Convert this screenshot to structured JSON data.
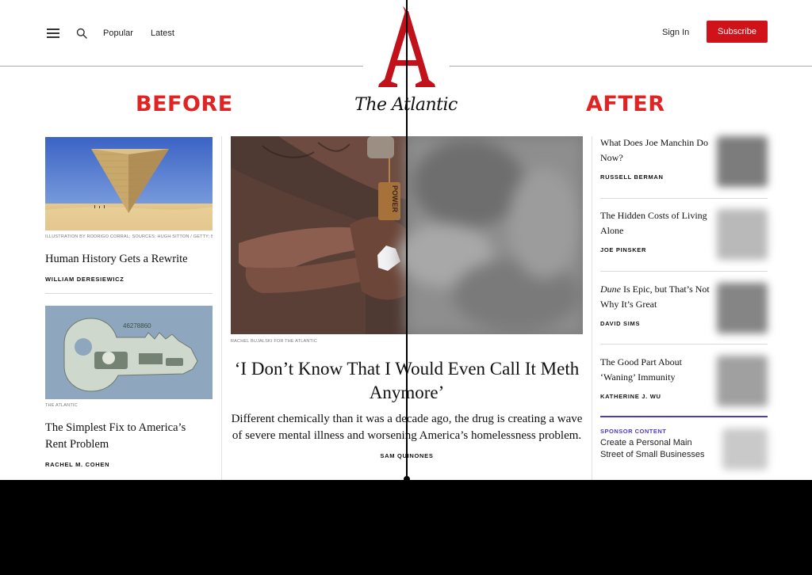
{
  "nav": {
    "popular": "Popular",
    "latest": "Latest",
    "sign_in": "Sign In",
    "subscribe": "Subscribe"
  },
  "brand": {
    "logo_letter": "A",
    "wordmark": "The Atlantic",
    "brand_red": "#d0121b"
  },
  "labels": {
    "before": "BEFORE",
    "after": "AFTER",
    "label_color": "#e02424"
  },
  "left_column": [
    {
      "credit": "ILLUSTRATION BY RODRIGO CORRAL; SOURCES: HUGH SITTON / GETTY; BE...",
      "headline": "Human History Gets a Rewrite",
      "byline": "WILLIAM DERESIEWICZ",
      "image": "inverted-pyramid-desert"
    },
    {
      "credit": "THE ATLANTIC",
      "headline": "The Simplest Fix to America’s Rent Problem",
      "byline": "RACHEL M. COHEN",
      "image": "dollar-bill-key"
    }
  ],
  "hero": {
    "credit": "RACHEL BUJALSKI FOR THE ATLANTIC",
    "pendant_text": "POWER",
    "headline": "‘I Don’t Know That I Would Even Call It Meth Anymore’",
    "dek": "Different chemically than it was a decade ago, the drug is creating a wave of severe mental illness and worsening America’s homelessness problem.",
    "byline": "SAM QUINONES"
  },
  "right_column": [
    {
      "headline": "What Does Joe Manchin Do Now?",
      "byline": "RUSSELL BERMAN",
      "headline_italic": "",
      "headline_rest": ""
    },
    {
      "headline": "The Hidden Costs of Living Alone",
      "byline": "JOE PINSKER",
      "headline_italic": "",
      "headline_rest": ""
    },
    {
      "headline": "",
      "headline_italic": "Dune",
      "headline_rest": " Is Epic, but That’s Not Why It’s Great",
      "byline": "DAVID SIMS"
    },
    {
      "headline": "The Good Part About ‘Waning’ Immunity",
      "byline": "KATHERINE J. WU",
      "headline_italic": "",
      "headline_rest": ""
    }
  ],
  "sponsor": {
    "label": "SPONSOR CONTENT",
    "headline": "Create a Personal Main Street of Small Businesses",
    "accent": "#4a3cc2"
  }
}
